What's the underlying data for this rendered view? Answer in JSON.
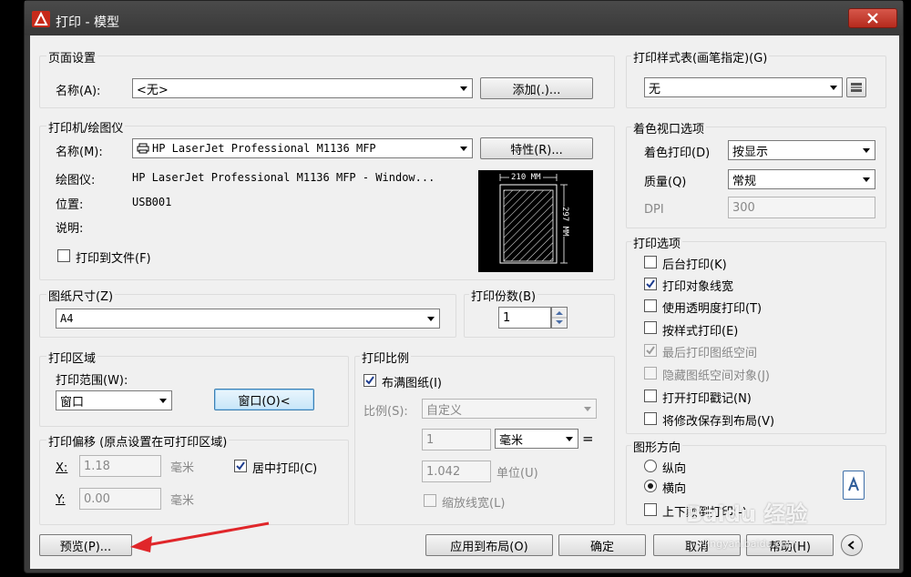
{
  "window": {
    "title": "打印 - 模型"
  },
  "page_setup": {
    "group_label": "页面设置",
    "name_label": "名称(A):",
    "name_value": "<无>",
    "add_button": "添加(.)..."
  },
  "printer": {
    "group_label": "打印机/绘图仪",
    "name_label": "名称(M):",
    "name_value": "HP LaserJet Professional M1136 MFP",
    "properties_button": "特性(R)...",
    "plotter_label": "绘图仪:",
    "plotter_value": "HP LaserJet Professional M1136 MFP - Window...",
    "location_label": "位置:",
    "location_value": "USB001",
    "description_label": "说明:",
    "print_to_file": "打印到文件(F)",
    "print_to_file_checked": false,
    "preview_width": "210 MM",
    "preview_height": "297 MM"
  },
  "paper_size": {
    "group_label": "图纸尺寸(Z)",
    "value": "A4"
  },
  "copies": {
    "group_label": "打印份数(B)",
    "value": "1"
  },
  "plot_area": {
    "group_label": "打印区域",
    "range_label": "打印范围(W):",
    "range_value": "窗口",
    "window_button": "窗口(O)<"
  },
  "plot_offset": {
    "group_label": "打印偏移 (原点设置在可打印区域)",
    "x_label": "X:",
    "x_value": "1.18",
    "x_unit": "毫米",
    "y_label": "Y:",
    "y_value": "0.00",
    "y_unit": "毫米",
    "center_label": "居中打印(C)",
    "center_checked": true
  },
  "plot_scale": {
    "group_label": "打印比例",
    "fit_label": "布满图纸(I)",
    "fit_checked": true,
    "scale_label": "比例(S):",
    "scale_value": "自定义",
    "value1": "1",
    "unit_value": "毫米",
    "equals": "=",
    "value2": "1.042",
    "unit2": "单位(U)",
    "lineweights_label": "缩放线宽(L)"
  },
  "plot_style": {
    "group_label": "打印样式表(画笔指定)(G)",
    "value": "无"
  },
  "shaded_viewport": {
    "group_label": "着色视口选项",
    "shade_label": "着色打印(D)",
    "shade_value": "按显示",
    "quality_label": "质量(Q)",
    "quality_value": "常规",
    "dpi_label": "DPI",
    "dpi_value": "300"
  },
  "plot_options": {
    "group_label": "打印选项",
    "items": [
      {
        "label": "后台打印(K)",
        "checked": false,
        "disabled": false
      },
      {
        "label": "打印对象线宽",
        "checked": true,
        "disabled": false
      },
      {
        "label": "使用透明度打印(T)",
        "checked": false,
        "disabled": false
      },
      {
        "label": "按样式打印(E)",
        "checked": false,
        "disabled": false
      },
      {
        "label": "最后打印图纸空间",
        "checked": true,
        "disabled": true
      },
      {
        "label": "隐藏图纸空间对象(J)",
        "checked": false,
        "disabled": true
      },
      {
        "label": "打开打印戳记(N)",
        "checked": false,
        "disabled": false
      },
      {
        "label": "将修改保存到布局(V)",
        "checked": false,
        "disabled": false
      }
    ]
  },
  "orientation": {
    "group_label": "图形方向",
    "portrait": "纵向",
    "landscape": "横向",
    "selected": "landscape",
    "upside_down": "上下颠倒打印(-)"
  },
  "footer": {
    "preview_button": "预览(P)...",
    "apply_button": "应用到布局(O)",
    "ok_button": "确定",
    "cancel_button": "取消",
    "help_button": "帮助(H)"
  },
  "watermark": {
    "text": "Baidu 经验",
    "url": "jingyan.baidu.com"
  },
  "colors": {
    "arrow": "#e0262a",
    "dialog_bg": "#f0f0f0",
    "frame": "#3b3b3b"
  }
}
